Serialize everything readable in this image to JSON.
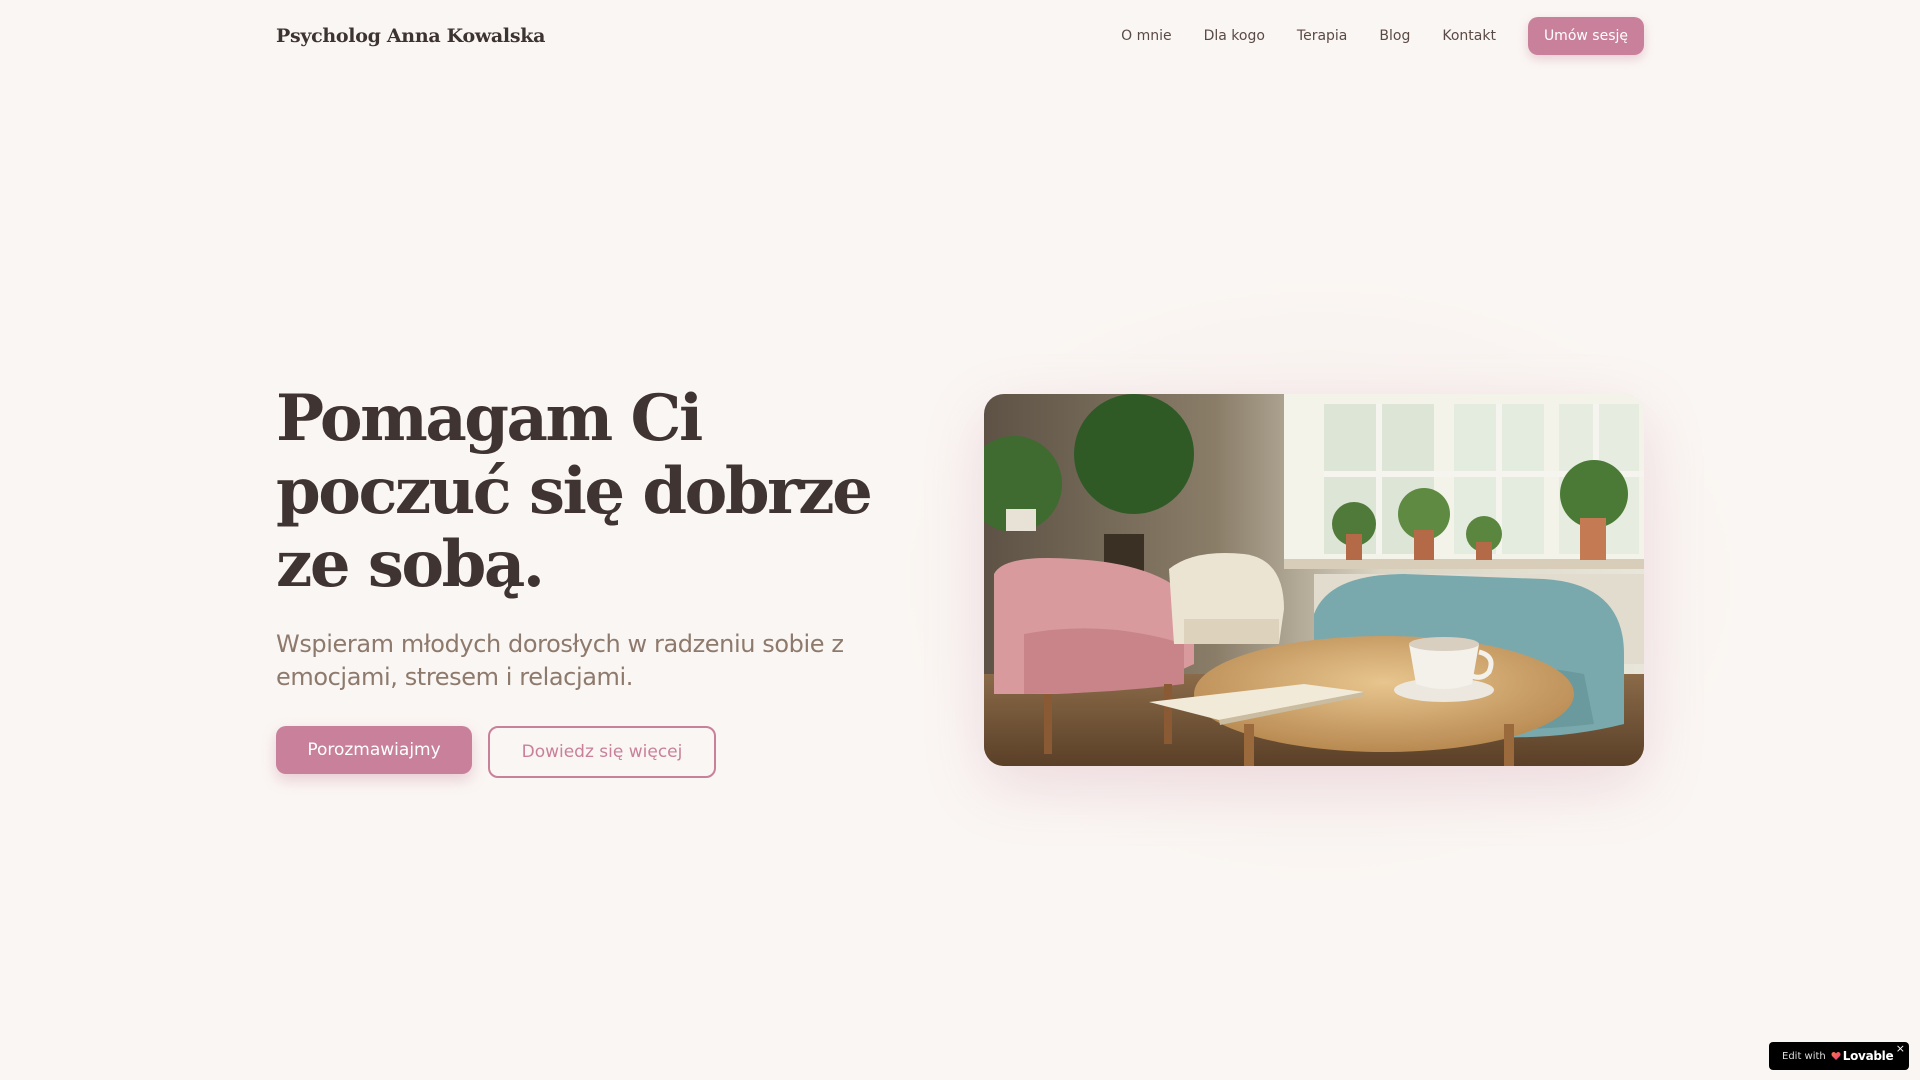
{
  "header": {
    "brand": "Psycholog Anna Kowalska",
    "nav": [
      {
        "label": "O mnie"
      },
      {
        "label": "Dla kogo"
      },
      {
        "label": "Terapia"
      },
      {
        "label": "Blog"
      },
      {
        "label": "Kontakt"
      }
    ],
    "cta_label": "Umów sesję"
  },
  "hero": {
    "title_lines": [
      "Pomagam Ci",
      "poczuć się dobrze",
      "ze sobą."
    ],
    "subtitle": "Wspieram młodych dorosłych w radzeniu sobie z emocjami, stresem i relacjami.",
    "primary_button": "Porozmawiajmy",
    "secondary_button": "Dowiedz się więcej",
    "image": "therapy-room-photo"
  },
  "badge": {
    "prefix": "Edit with",
    "brand": "Lovable",
    "close": "×"
  },
  "colors": {
    "background": "#faf6f3",
    "accent": "#c9809a",
    "heading": "#3f3431",
    "subtitle": "#8e7a6d"
  }
}
